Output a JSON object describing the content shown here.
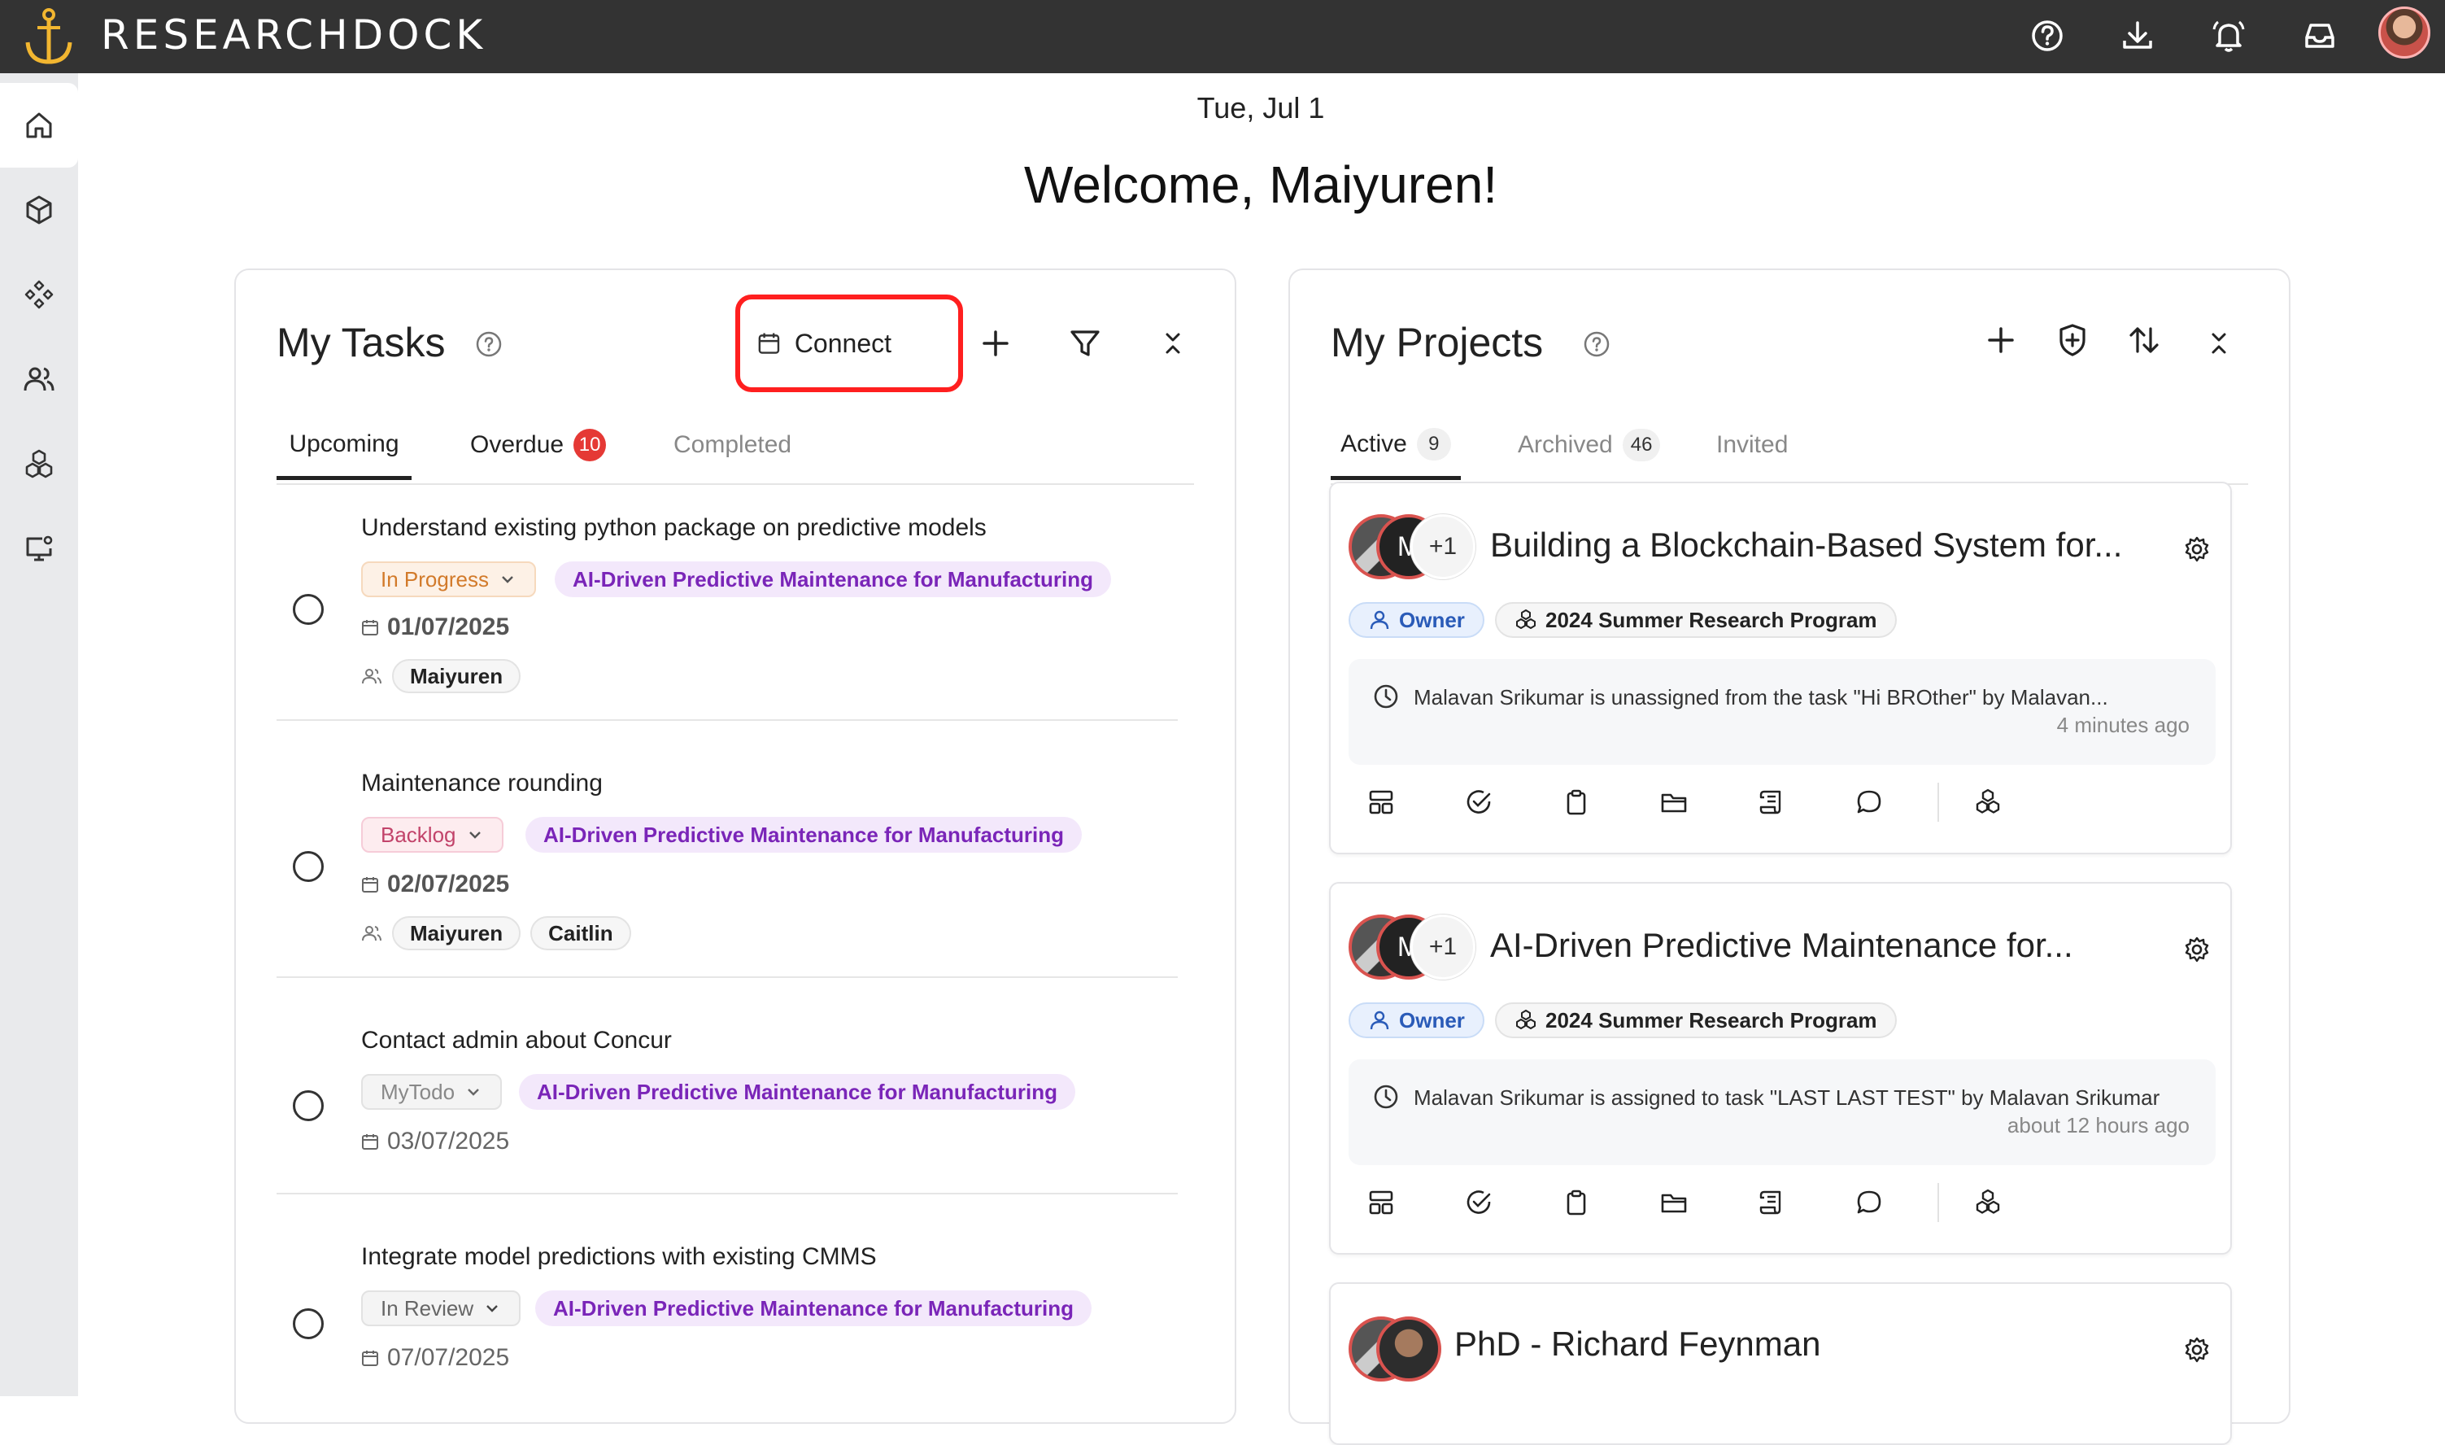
{
  "app": {
    "brand": "RESEARCHDOCK"
  },
  "colors": {
    "topbar": "#333333",
    "accent_gold": "#f2b630",
    "highlight_red": "#ff1f1f",
    "project_purple": "#7a25b8"
  },
  "header": {
    "date": "Tue, Jul 1",
    "welcome": "Welcome, Maiyuren!"
  },
  "tasks_panel": {
    "title": "My Tasks",
    "connect_label": "Connect",
    "tabs": {
      "upcoming": "Upcoming",
      "overdue": "Overdue",
      "overdue_count": "10",
      "completed": "Completed"
    },
    "items": [
      {
        "title": "Understand existing python package on predictive models",
        "status": "In Progress",
        "project": "AI-Driven Predictive Maintenance for Manufacturing",
        "date": "01/07/2025",
        "assignees": [
          "Maiyuren"
        ]
      },
      {
        "title": "Maintenance rounding",
        "status": "Backlog",
        "project": "AI-Driven Predictive Maintenance for Manufacturing",
        "date": "02/07/2025",
        "assignees": [
          "Maiyuren",
          "Caitlin"
        ]
      },
      {
        "title": "Contact admin about Concur",
        "status": "MyTodo",
        "project": "AI-Driven Predictive Maintenance for Manufacturing",
        "date": "03/07/2025"
      },
      {
        "title": "Integrate model predictions with existing CMMS",
        "status": "In Review",
        "project": "AI-Driven Predictive Maintenance for Manufacturing",
        "date": "07/07/2025"
      }
    ]
  },
  "projects_panel": {
    "title": "My Projects",
    "tabs": {
      "active": "Active",
      "active_count": "9",
      "archived": "Archived",
      "archived_count": "46",
      "invited": "Invited"
    },
    "items": [
      {
        "title": "Building a Blockchain-Based System for...",
        "avatar_initial": "M",
        "extra_members": "+1",
        "role": "Owner",
        "program": "2024 Summer Research Program",
        "activity": "Malavan Srikumar is unassigned from the task \"Hi BROther\" by Malavan...",
        "activity_time": "4 minutes ago"
      },
      {
        "title": "AI-Driven Predictive Maintenance for...",
        "avatar_initial": "M",
        "extra_members": "+1",
        "role": "Owner",
        "program": "2024 Summer Research Program",
        "activity": "Malavan Srikumar is assigned to task \"LAST LAST TEST\" by Malavan Srikumar",
        "activity_time": "about 12 hours ago"
      },
      {
        "title": "PhD - Richard Feynman"
      }
    ]
  }
}
